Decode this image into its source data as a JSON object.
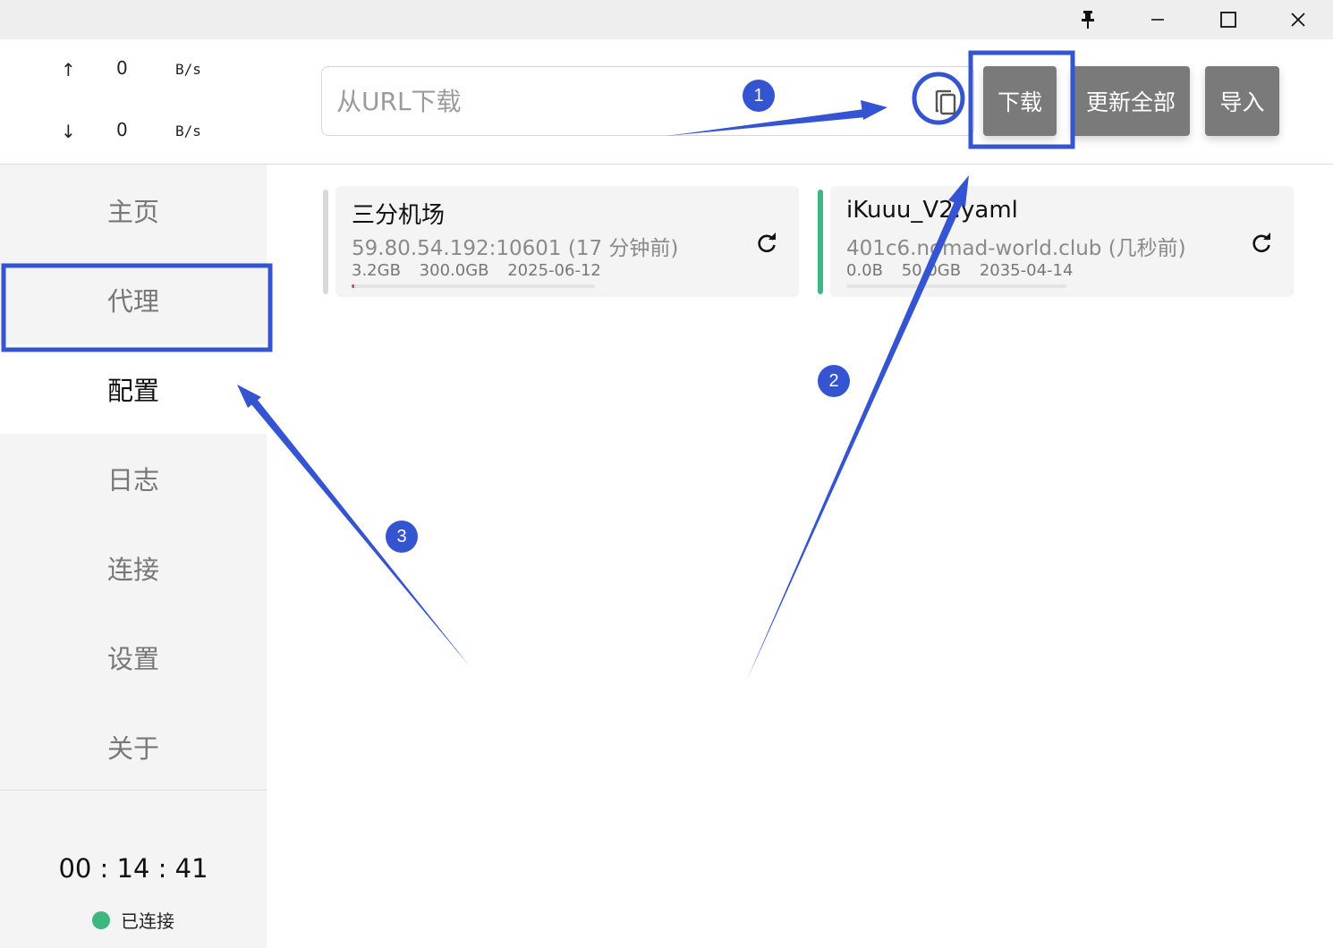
{
  "window_controls": {
    "pin_icon": "pin-icon",
    "minimize_icon": "minimize-icon",
    "maximize_icon": "maximize-icon",
    "close_icon": "close-icon"
  },
  "traffic": {
    "up": {
      "arrow": "↑",
      "value": "0",
      "unit": "B/s"
    },
    "down": {
      "arrow": "↓",
      "value": "0",
      "unit": "B/s"
    }
  },
  "nav": {
    "items": [
      {
        "label": "主页",
        "active": false
      },
      {
        "label": "代理",
        "active": false
      },
      {
        "label": "配置",
        "active": true
      },
      {
        "label": "日志",
        "active": false
      },
      {
        "label": "连接",
        "active": false
      },
      {
        "label": "设置",
        "active": false
      },
      {
        "label": "关于",
        "active": false
      }
    ]
  },
  "footer": {
    "timer": "00 : 14 : 41",
    "status": "已连接",
    "status_color": "#3db67f"
  },
  "toolbar": {
    "url_placeholder": "从URL下载",
    "url_value": "",
    "paste_icon": "paste-icon",
    "download_label": "下载",
    "update_all_label": "更新全部",
    "import_label": "导入",
    "button_color": "#7a7a7a"
  },
  "profiles": [
    {
      "name": "三分机场",
      "address": "59.80.54.192:10601 (17 分钟前)",
      "used": "3.2GB",
      "total": "300.0GB",
      "expire": "2025-06-12",
      "usage_fraction": 0.011,
      "selected": false,
      "bar_color": "#d8d8d8"
    },
    {
      "name": "iKuuu_V2.yaml",
      "address": "401c6.nomad-world.club (几秒前)",
      "used": "0.0B",
      "total": "50.0GB",
      "expire": "2035-04-14",
      "usage_fraction": 0.0,
      "selected": true,
      "bar_color": "#3db67f"
    }
  ],
  "annotations": {
    "color": "#3554d1",
    "steps": [
      "1",
      "2",
      "3"
    ]
  }
}
